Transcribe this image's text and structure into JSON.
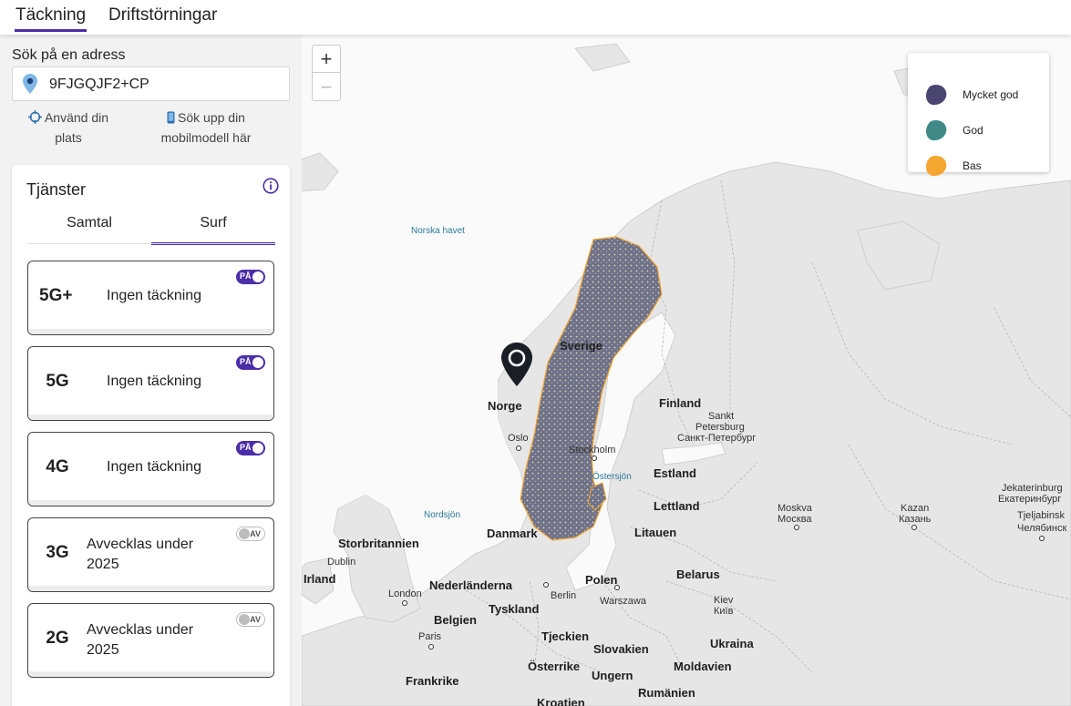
{
  "tabs": [
    {
      "label": "Täckning",
      "active": true
    },
    {
      "label": "Driftstörningar",
      "active": false
    }
  ],
  "search": {
    "label": "Sök på en adress",
    "value": "9FJGQJF2+CP"
  },
  "actions": {
    "use_location_line1": "Använd din",
    "use_location_line2": "plats",
    "phone_line1": "Sök upp din",
    "phone_line2": "mobilmodell här"
  },
  "services": {
    "title": "Tjänster",
    "tabs": [
      {
        "label": "Samtal",
        "active": false
      },
      {
        "label": "Surf",
        "active": true
      }
    ],
    "items": [
      {
        "name": "5G+",
        "status": "Ingen täckning",
        "toggle": "PÅ",
        "on": true
      },
      {
        "name": "5G",
        "status": "Ingen täckning",
        "toggle": "PÅ",
        "on": true
      },
      {
        "name": "4G",
        "status": "Ingen täckning",
        "toggle": "PÅ",
        "on": true
      },
      {
        "name": "3G",
        "status_line1": "Avvecklas under",
        "status_line2": "2025",
        "toggle": "AV",
        "on": false
      },
      {
        "name": "2G",
        "status_line1": "Avvecklas under",
        "status_line2": "2025",
        "toggle": "AV",
        "on": false
      }
    ]
  },
  "map": {
    "zoom_in": "+",
    "zoom_out": "−",
    "legend": [
      {
        "label": "Mycket god",
        "color": "#4a4470"
      },
      {
        "label": "God",
        "color": "#3f8a87"
      },
      {
        "label": "Bas",
        "color": "#f5a630"
      }
    ],
    "labels": {
      "norska_havet": "Norska havet",
      "nordsjon": "Nordsjön",
      "ostersjon": "Östersjön",
      "sverige": "Sverige",
      "norge": "Norge",
      "finland": "Finland",
      "danmark": "Danmark",
      "estland": "Estland",
      "lettland": "Lettland",
      "litauen": "Litauen",
      "storbritannien": "Storbritannien",
      "irland": "Irland",
      "nederlanderna": "Nederländerna",
      "belgien": "Belgien",
      "tyskland": "Tyskland",
      "polen": "Polen",
      "belarus": "Belarus",
      "tjeckien": "Tjeckien",
      "slovakien": "Slovakien",
      "osterrike": "Österrike",
      "ungern": "Ungern",
      "ukraina": "Ukraina",
      "moldavien": "Moldavien",
      "rumanien": "Rumänien",
      "frankrike": "Frankrike",
      "kroatien": "Kroatien",
      "oslo": "Oslo",
      "stockholm": "Stockholm",
      "sankt_1": "Sankt",
      "sankt_2": "Petersburg",
      "sankt_3": "Санкт-Петербург",
      "dublin": "Dublin",
      "london": "London",
      "paris": "Paris",
      "berlin": "Berlin",
      "warszawa": "Warszawa",
      "kiev_1": "Kiev",
      "kiev_2": "Київ",
      "moskva_1": "Moskva",
      "moskva_2": "Москва",
      "kazan_1": "Kazan",
      "kazan_2": "Казань",
      "jekat_1": "Jekaterinburg",
      "jekat_2": "Екатеринбург",
      "tjel_1": "Tjeljabinsk",
      "tjel_2": "Челябинск"
    }
  }
}
